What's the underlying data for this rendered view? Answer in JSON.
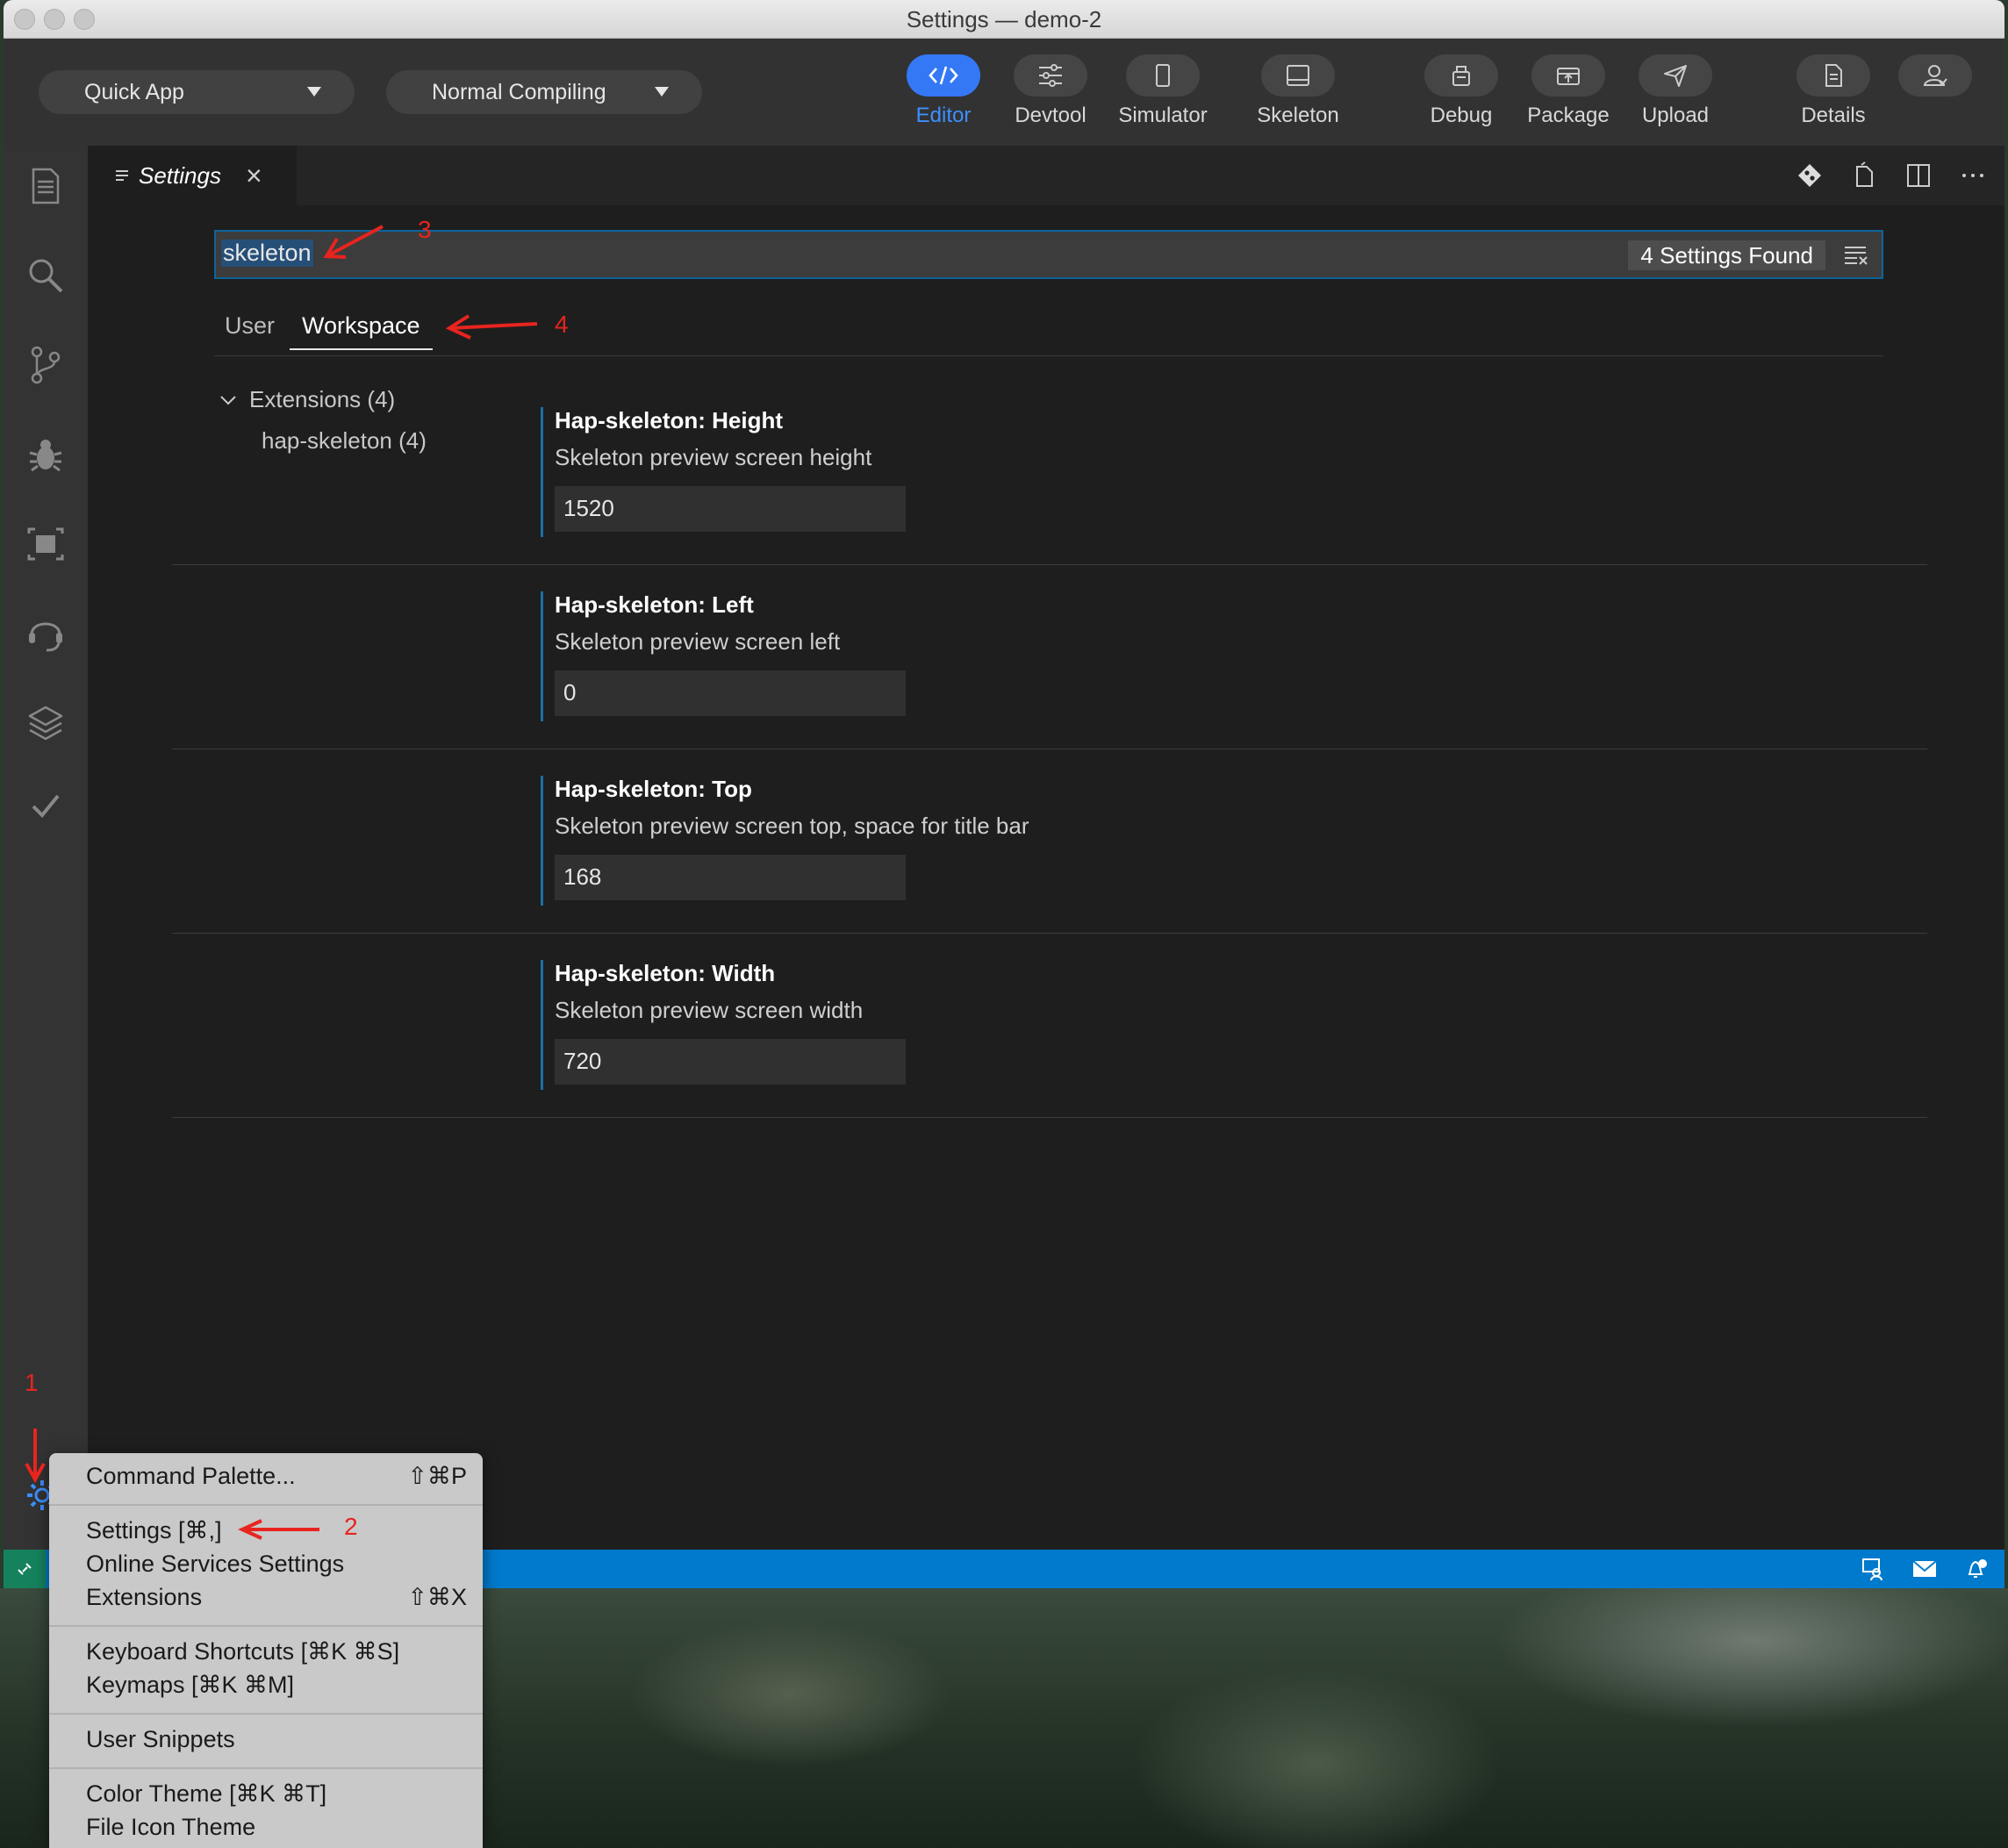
{
  "window": {
    "title": "Settings — demo-2"
  },
  "toolbar": {
    "project_dropdown": "Quick App",
    "compile_dropdown": "Normal Compiling",
    "tools": [
      {
        "label": "Editor",
        "icon": "code-icon",
        "active": true
      },
      {
        "label": "Devtool",
        "icon": "sliders-icon",
        "active": false
      },
      {
        "label": "Simulator",
        "icon": "phone-icon",
        "active": false
      },
      {
        "label": "Skeleton",
        "icon": "skeleton-layout-icon",
        "active": false
      },
      {
        "label": "Debug",
        "icon": "debug-device-icon",
        "active": false
      },
      {
        "label": "Package",
        "icon": "package-icon",
        "active": false
      },
      {
        "label": "Upload",
        "icon": "send-icon",
        "active": false
      },
      {
        "label": "Details",
        "icon": "document-icon",
        "active": false
      }
    ],
    "account_icon": "user-icon"
  },
  "activity_bar": [
    "explorer-icon",
    "search-icon",
    "source-control-icon",
    "debug-bug-icon",
    "extensions-icon",
    "support-headset-icon",
    "layers-icon",
    "check-icon",
    "gear-icon"
  ],
  "tab": {
    "label": "Settings",
    "close": "×"
  },
  "search": {
    "query": "skeleton",
    "found": "4 Settings Found"
  },
  "scopes": {
    "user": "User",
    "workspace": "Workspace"
  },
  "tree": {
    "group": "Extensions (4)",
    "child": "hap-skeleton (4)"
  },
  "settings": [
    {
      "prefix": "Hap-skeleton: ",
      "name": "Height",
      "description": "Skeleton preview screen height",
      "value": "1520"
    },
    {
      "prefix": "Hap-skeleton: ",
      "name": "Left",
      "description": "Skeleton preview screen left",
      "value": "0"
    },
    {
      "prefix": "Hap-skeleton: ",
      "name": "Top",
      "description": "Skeleton preview screen top, space for title bar",
      "value": "168"
    },
    {
      "prefix": "Hap-skeleton: ",
      "name": "Width",
      "description": "Skeleton preview screen width",
      "value": "720"
    }
  ],
  "menu": {
    "command_palette": "Command Palette...",
    "command_palette_shortcut": "⇧⌘P",
    "settings": "Settings [⌘,]",
    "online_services": "Online Services Settings",
    "extensions": "Extensions",
    "extensions_shortcut": "⇧⌘X",
    "keyboard_shortcuts": "Keyboard Shortcuts [⌘K ⌘S]",
    "keymaps": "Keymaps [⌘K ⌘M]",
    "user_snippets": "User Snippets",
    "color_theme": "Color Theme [⌘K ⌘T]",
    "file_icon_theme": "File Icon Theme"
  },
  "annotations": [
    "1",
    "2",
    "3",
    "4"
  ],
  "colors": {
    "accent": "#3478f6",
    "statusbar": "#007acc",
    "annotation": "#e8241f"
  }
}
